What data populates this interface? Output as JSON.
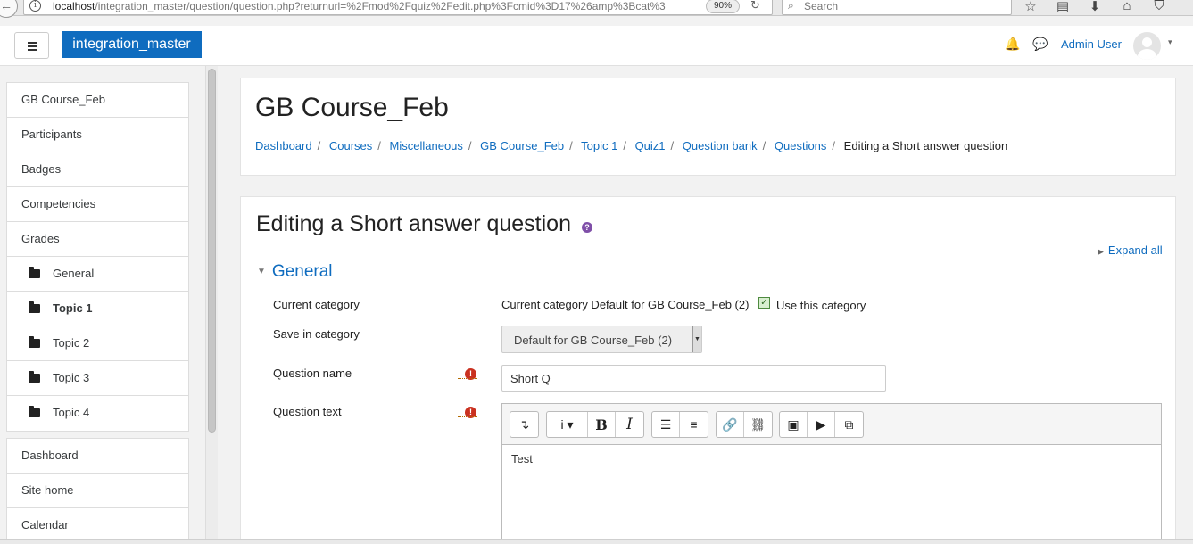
{
  "browser": {
    "back_glyph": "←",
    "info_glyph": "i",
    "url_host": "localhost",
    "url_path": "/integration_master/question/question.php?returnurl=%2Fmod%2Fquiz%2Fedit.php%3Fcmid%3D17%26amp%3Bcat%3",
    "zoom": "90%",
    "reload_glyph": "↻",
    "search_placeholder": "Search",
    "search_glyph": "⌕",
    "icons": {
      "bookmark": "☆",
      "reader": "▤",
      "download": "⬇",
      "home": "⌂",
      "pocket": "⛉"
    }
  },
  "navbar": {
    "site_name": "integration_master",
    "bell_glyph": "🔔",
    "message_glyph": "💬",
    "user_name": "Admin User",
    "caret": "▾"
  },
  "drawer": {
    "course_items": [
      {
        "label": "GB Course_Feb"
      },
      {
        "label": "Participants"
      },
      {
        "label": "Badges"
      },
      {
        "label": "Competencies"
      },
      {
        "label": "Grades"
      },
      {
        "label": "General"
      },
      {
        "label": "Topic 1"
      },
      {
        "label": "Topic 2"
      },
      {
        "label": "Topic 3"
      },
      {
        "label": "Topic 4"
      }
    ],
    "site_items": [
      {
        "label": "Dashboard"
      },
      {
        "label": "Site home"
      },
      {
        "label": "Calendar"
      }
    ]
  },
  "header": {
    "title": "GB Course_Feb",
    "breadcrumb": [
      "Dashboard",
      "Courses",
      "Miscellaneous",
      "GB Course_Feb",
      "Topic 1",
      "Quiz1",
      "Question bank",
      "Questions"
    ],
    "breadcrumb_current": "Editing a Short answer question",
    "separator": "/"
  },
  "main": {
    "heading": "Editing a Short answer question",
    "help_glyph": "?",
    "expand_all": "Expand all",
    "expand_glyph": "▶",
    "section_caret": "▼",
    "section_title": "General",
    "fields": {
      "current_category_label": "Current category",
      "current_category_value": "Current category Default for GB Course_Feb (2)",
      "use_category_glyph": "✓",
      "use_category_label": "Use this category",
      "save_in_category_label": "Save in category",
      "save_in_category_value": "Default for GB Course_Feb (2)",
      "select_arrow": "▼",
      "question_name_label": "Question name",
      "question_name_value": "Short Q",
      "question_text_label": "Question text",
      "question_text_value": "Test",
      "required_glyph": "!"
    },
    "editor_toolbar": {
      "collapse": "↴",
      "style": "i ▾",
      "bold": "B",
      "italic": "I",
      "bullet_list": "☰",
      "numbered_list": "≡",
      "link": "🔗",
      "unlink": "⛓",
      "image": "▣",
      "media": "▶",
      "manage_files": "⧉"
    }
  }
}
